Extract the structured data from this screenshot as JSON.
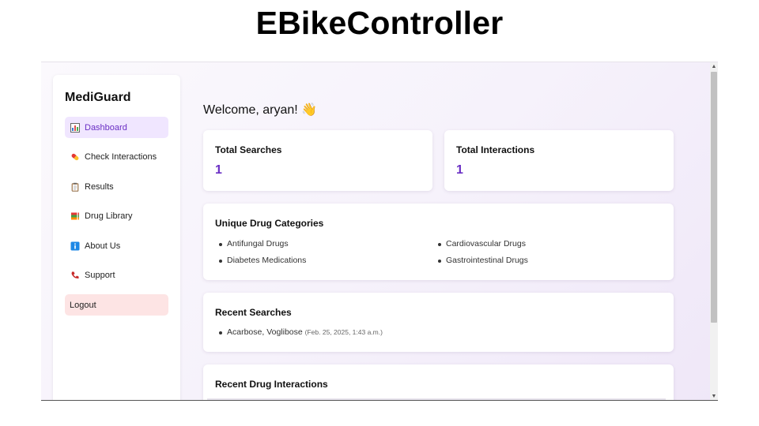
{
  "slide_title": "EBikeController",
  "sidebar": {
    "brand": "MediGuard",
    "items": [
      {
        "label": "Dashboard",
        "icon": "bar-chart-icon",
        "active": true
      },
      {
        "label": "Check Interactions",
        "icon": "pill-icon"
      },
      {
        "label": "Results",
        "icon": "clipboard-icon"
      },
      {
        "label": "Drug Library",
        "icon": "books-icon"
      },
      {
        "label": "About Us",
        "icon": "info-icon"
      },
      {
        "label": "Support",
        "icon": "phone-icon"
      },
      {
        "label": "Logout"
      }
    ]
  },
  "main": {
    "welcome": "Welcome, aryan! 👋",
    "total_searches": {
      "title": "Total Searches",
      "value": "1"
    },
    "total_interactions": {
      "title": "Total Interactions",
      "value": "1"
    },
    "categories": {
      "title": "Unique Drug Categories",
      "left": [
        "Antifungal Drugs",
        "Diabetes Medications"
      ],
      "right": [
        "Cardiovascular Drugs",
        "Gastrointestinal Drugs"
      ]
    },
    "recent_searches": {
      "title": "Recent Searches",
      "items": [
        {
          "drugs": "Acarbose, Voglibose",
          "time": "(Feb. 25, 2025, 1:43 a.m.)"
        }
      ]
    },
    "recent_interactions": {
      "title": "Recent Drug Interactions"
    }
  },
  "colors": {
    "accent": "#6a2fc4",
    "active_bg": "#f0e6ff",
    "logout_bg": "#fde4e4"
  }
}
